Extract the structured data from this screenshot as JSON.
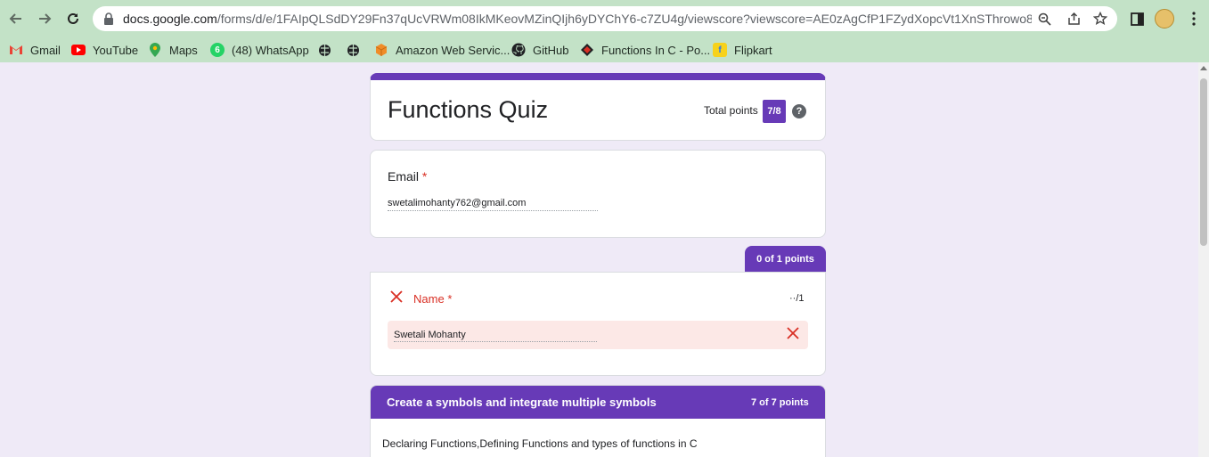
{
  "browser": {
    "url_host": "docs.google.com",
    "url_path": "/forms/d/e/1FAIpQLSdDY29Fn37qUcVRWm08IkMKeovMZinQIjh6yDYChY6-c7ZU4g/viewscore?viewscore=AE0zAgCfP1FZydXopcVt1XnSThrowo8V...",
    "bookmarks": [
      "Gmail",
      "YouTube",
      "Maps",
      "(48) WhatsApp",
      "Amazon Web Servic...",
      "GitHub",
      "Functions In C - Po...",
      "Flipkart"
    ],
    "whatsapp_badge": "6"
  },
  "form": {
    "title": "Functions Quiz",
    "total_points_label": "Total points",
    "total_points_value": "7/8",
    "help_icon_glyph": "?",
    "email": {
      "label": "Email",
      "required_mark": "*",
      "value": "swetalimohanty762@gmail.com"
    },
    "name_question": {
      "points_tab": "0 of 1 points",
      "label": "Name",
      "required_mark": "*",
      "score": "··/1",
      "answer": "Swetali Mohanty"
    },
    "section": {
      "title": "Create a symbols and integrate multiple symbols",
      "points": "7 of 7 points",
      "description": "Declaring Functions,Defining Functions and types of functions in C"
    }
  },
  "colors": {
    "accent": "#673ab7",
    "error": "#d93025",
    "chrome": "#c3e2c7",
    "page_bg": "#efeaf7"
  }
}
